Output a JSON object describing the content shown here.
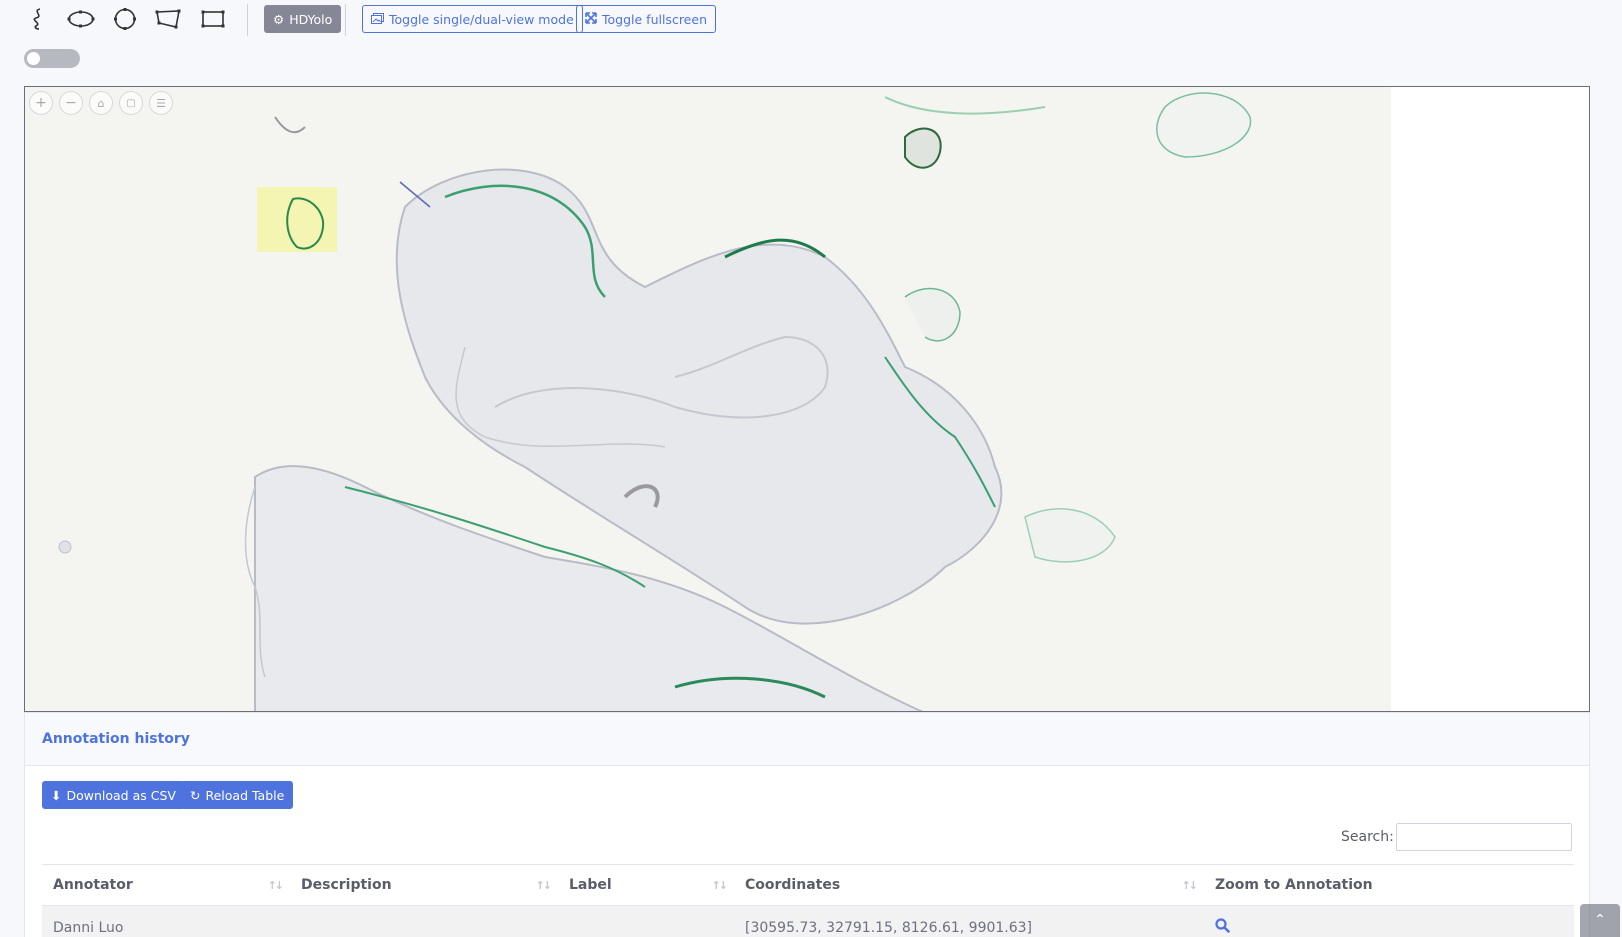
{
  "toolbar": {
    "tools": [
      {
        "name": "freehand-tool-icon"
      },
      {
        "name": "ellipse-tool-icon"
      },
      {
        "name": "circle-tool-icon"
      },
      {
        "name": "polygon-tool-icon"
      },
      {
        "name": "rectangle-tool-icon"
      }
    ],
    "hdyolo_label": "HDYolo",
    "toggle_view_label": "Toggle single/dual-view mode",
    "toggle_fullscreen_label": "Toggle fullscreen"
  },
  "switch": {
    "state": "off"
  },
  "viewer": {
    "nav_buttons": [
      "zoom-in-icon",
      "zoom-out-icon",
      "home-icon",
      "fullpage-icon",
      "layers-icon"
    ]
  },
  "annotation_history": {
    "title": "Annotation history",
    "download_label": "Download as CSV",
    "reload_label": "Reload Table",
    "search_label": "Search:",
    "search_value": "",
    "columns": [
      "Annotator",
      "Description",
      "Label",
      "Coordinates",
      "Zoom to Annotation"
    ],
    "rows": [
      {
        "annotator": "Danni Luo",
        "description": "",
        "label": "",
        "coordinates": "[30595.73, 32791.15, 8126.61, 9901.63]",
        "zoom_icon": "search-icon"
      }
    ]
  },
  "colors": {
    "accent": "#4e73df",
    "gray_button": "#858796",
    "highlight": "#f3f3a8",
    "stain": "#2a9a6a"
  }
}
